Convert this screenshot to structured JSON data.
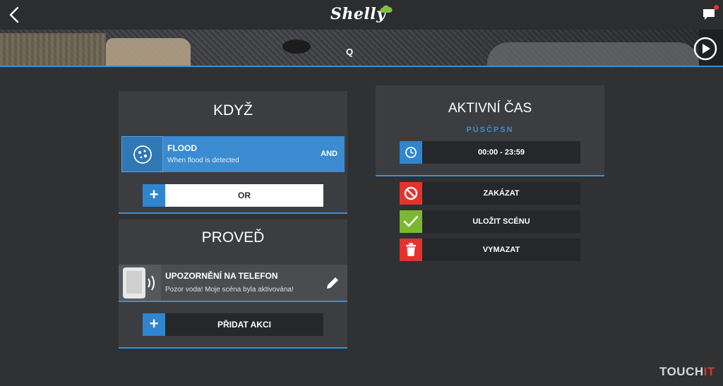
{
  "app": {
    "logo_text": "Shelly"
  },
  "banner": {
    "scene_name": "Q"
  },
  "when": {
    "title": "KDYŽ",
    "trigger": {
      "name": "FLOOD",
      "description": "When flood is detected",
      "operator": "AND"
    },
    "or_label": "OR"
  },
  "action": {
    "title": "PROVEĎ",
    "item": {
      "name": "UPOZORNĚNÍ NA TELEFON",
      "description": "Pozor voda! Moje scéna byla aktivována!"
    },
    "add_label": "PŘIDAT AKCI"
  },
  "active_time": {
    "title": "AKTIVNÍ ČAS",
    "days": "PÚSČPSN",
    "range": "00:00 - 23:59"
  },
  "buttons": {
    "disable": "ZAKÁZAT",
    "save": "ULOŽIT SCÉNU",
    "delete": "VYMAZAT"
  },
  "watermark": {
    "main": "TOUCH",
    "accent": "IT"
  },
  "colors": {
    "accent_blue": "#3b8fd3",
    "disable_red": "#e5322d",
    "save_green": "#7cb82f",
    "delete_red": "#e5322d"
  },
  "icons": {
    "back": "chevron-left-icon",
    "chat": "chat-notification-icon",
    "play": "play-circle-icon",
    "trigger": "flood-sensor-icon",
    "action": "phone-notification-icon",
    "edit": "pencil-icon",
    "clock": "clock-icon",
    "disable": "forbidden-icon",
    "save": "checkmark-icon",
    "delete": "trash-icon"
  }
}
